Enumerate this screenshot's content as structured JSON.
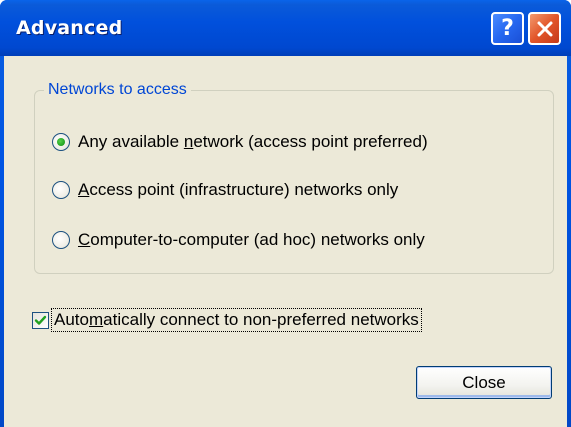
{
  "window": {
    "title": "Advanced"
  },
  "titlebar": {
    "help_glyph": "?",
    "close_icon": "close-x-icon"
  },
  "group": {
    "legend": "Networks to access",
    "options": [
      {
        "pre": "Any available ",
        "key": "n",
        "post": "etwork (access point preferred)",
        "checked": true
      },
      {
        "pre": "",
        "key": "A",
        "post": "ccess point (infrastructure) networks only",
        "checked": false
      },
      {
        "pre": "",
        "key": "C",
        "post": "omputer-to-computer (ad hoc) networks only",
        "checked": false
      }
    ]
  },
  "auto_connect": {
    "pre": "Auto",
    "key": "m",
    "post": "atically connect to non-preferred networks",
    "checked": true
  },
  "buttons": {
    "close": "Close"
  },
  "colors": {
    "titlebar": "#0054e3",
    "client_bg": "#ece9d8",
    "legend_text": "#0046d5",
    "check_green": "#21a121",
    "close_button_red": "#e2562a"
  }
}
